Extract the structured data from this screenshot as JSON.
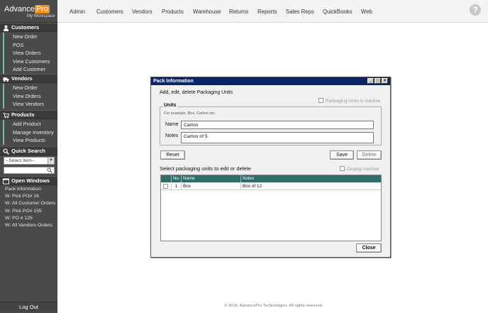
{
  "brand": {
    "name": "Advance",
    "pro": "Pro",
    "subtitle": "My Workspace"
  },
  "sidebar": {
    "customers": {
      "title": "Customers",
      "items": [
        "New Order",
        "POS",
        "View Orders",
        "View Customers",
        "Add Customer"
      ]
    },
    "vendors": {
      "title": "Vendors",
      "items": [
        "New Order",
        "View Orders",
        "View Vendors"
      ]
    },
    "products": {
      "title": "Products",
      "items": [
        "Add Product",
        "Manage Inventory",
        "View Products"
      ]
    },
    "quick_search": {
      "title": "Quick Search",
      "select_value": "--Select Item--"
    },
    "open_windows": {
      "title": "Open Windows",
      "items": [
        "Pack Information",
        "W: Pick PO# 16",
        "W: All Customer Orders",
        "W: Pick PO# 155",
        "W: PO # 125",
        "W: All Vendors Orders"
      ]
    },
    "logout": "Log Out"
  },
  "topnav": [
    "Admin",
    "Customers",
    "Vendors",
    "Products",
    "Warehouse",
    "Returns",
    "Reports",
    "Sales Reps",
    "QuickBooks",
    "Web"
  ],
  "footer": "© 2018, AdvancePro Technologies. All rights reserved.",
  "dialog": {
    "title": "Pack Information",
    "subtitle": "Add, edit, delete Packaging Units",
    "inactive_checkbox": "Packaging Units is inactive",
    "units_legend": "Units",
    "units_hint": "For example, Box, Carton etc.",
    "name_label": "Name",
    "name_value": "Carton",
    "notes_label": "Notes",
    "notes_value": "Carton of 5",
    "reset": "Reset",
    "save": "Save",
    "delete": "Delete",
    "grid_caption": "Select packaging units to edit or delete",
    "display_inactive": "Display inactive",
    "columns": [
      "No.",
      "Name",
      "Notes"
    ],
    "rows": [
      {
        "no": "1",
        "name": "Box",
        "notes": "Box of 12"
      }
    ],
    "close": "Close"
  },
  "icons": {
    "customers": "person-icon",
    "vendors": "truck-icon",
    "products": "cart-icon",
    "search": "magnifier-icon",
    "windows": "window-icon",
    "help": "question-icon"
  }
}
